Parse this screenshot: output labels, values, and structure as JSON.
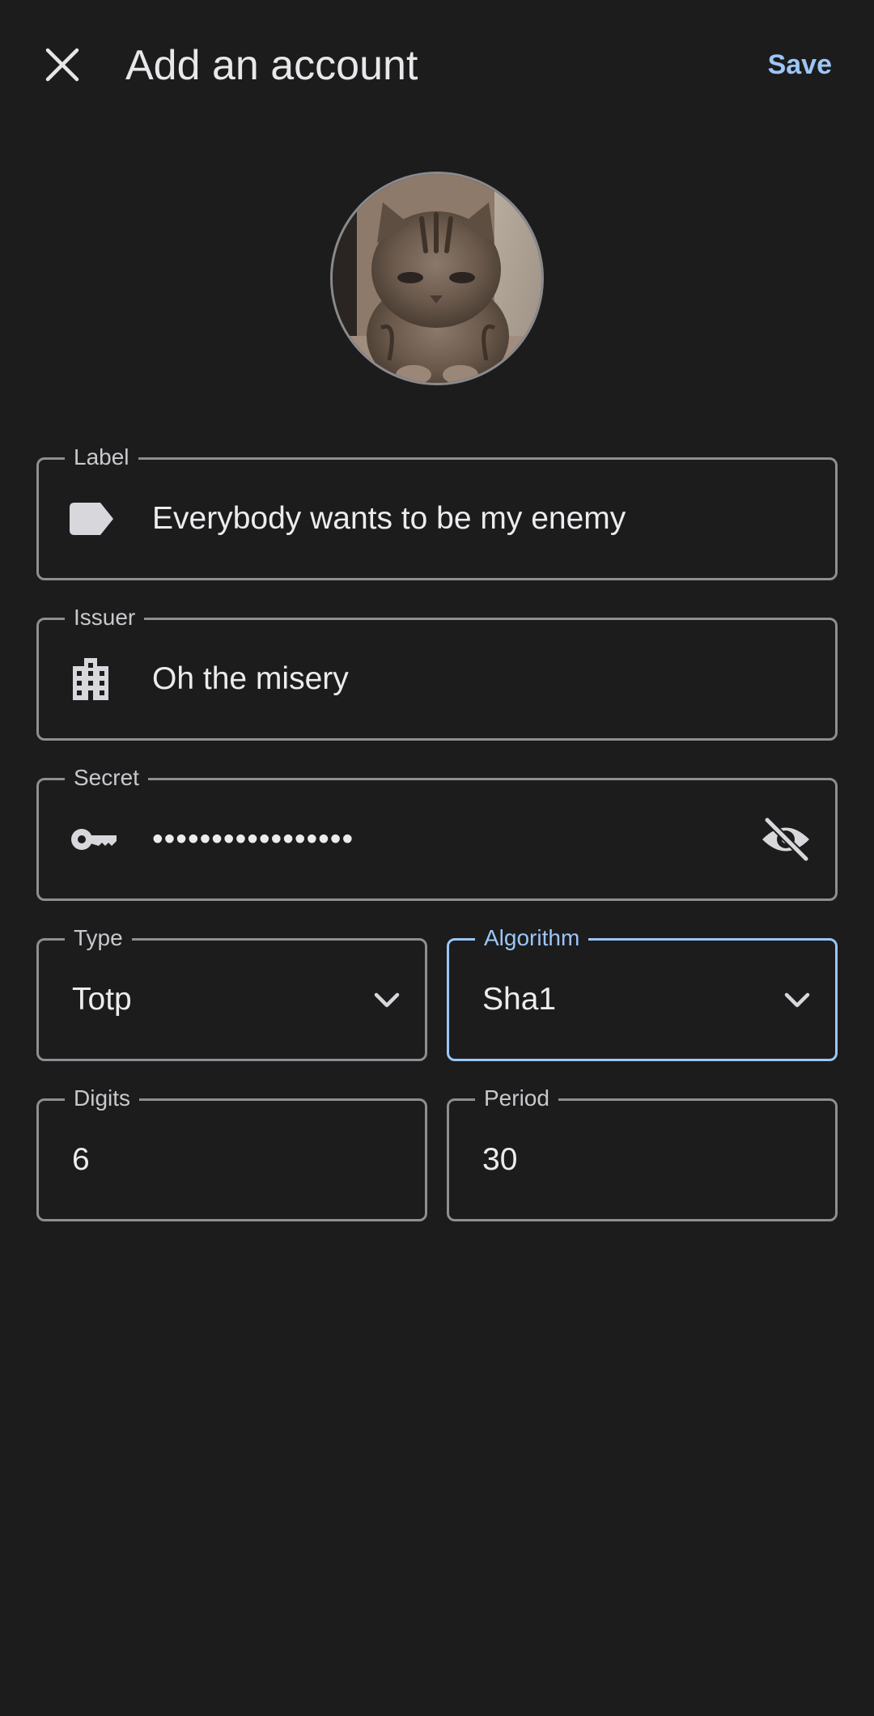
{
  "header": {
    "title": "Add an account",
    "save_label": "Save",
    "close_icon": "close-icon"
  },
  "avatar": {
    "alt": "cat photo",
    "icon": "account-avatar"
  },
  "fields": {
    "label": {
      "label": "Label",
      "value": "Everybody wants to be my enemy",
      "icon": "tag-icon"
    },
    "issuer": {
      "label": "Issuer",
      "value": "Oh the misery",
      "icon": "building-icon"
    },
    "secret": {
      "label": "Secret",
      "value": "•••••••••••••••••",
      "icon": "key-icon",
      "toggle_icon": "eye-off-icon"
    },
    "type": {
      "label": "Type",
      "value": "Totp",
      "icon": "chevron-down-icon"
    },
    "algorithm": {
      "label": "Algorithm",
      "value": "Sha1",
      "icon": "chevron-down-icon",
      "focused": true
    },
    "digits": {
      "label": "Digits",
      "value": "6"
    },
    "period": {
      "label": "Period",
      "value": "30"
    }
  },
  "colors": {
    "background": "#1c1c1d",
    "accent": "#9cc6f5",
    "outline": "#8e8e93",
    "text": "#ececee"
  }
}
